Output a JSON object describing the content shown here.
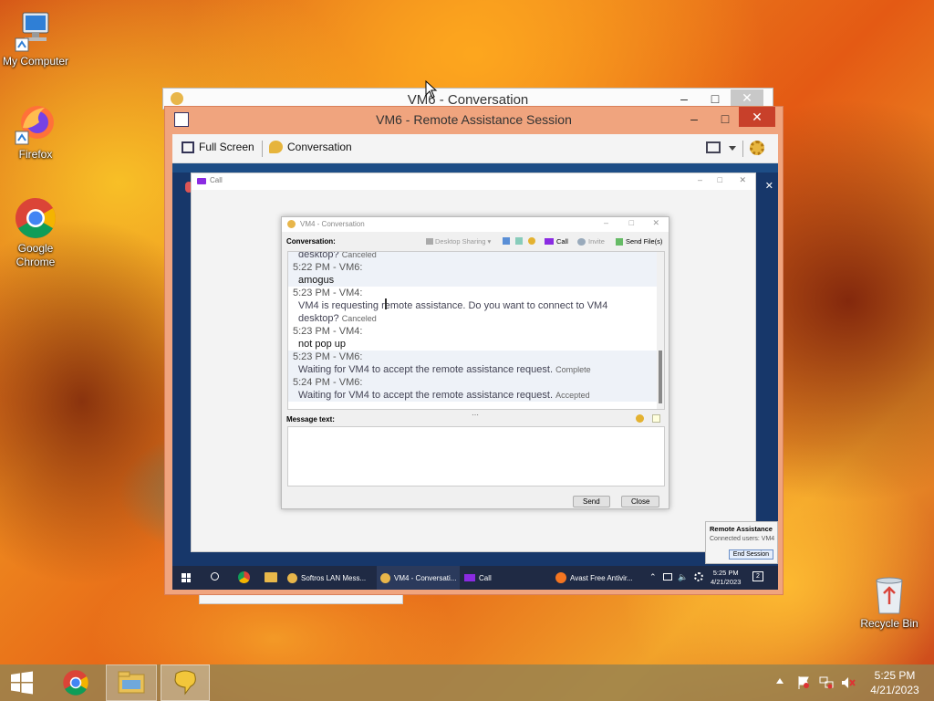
{
  "desktop": {
    "icons": [
      {
        "label": "My Computer",
        "icon": "computer-icon"
      },
      {
        "label": "Firefox",
        "icon": "firefox-icon"
      },
      {
        "label": "Google Chrome",
        "icon": "chrome-icon"
      },
      {
        "label": "Recycle Bin",
        "icon": "recycle-bin-icon"
      }
    ]
  },
  "bg_window": {
    "title": "VM6 - Conversation"
  },
  "ra_window": {
    "title": "VM6 - Remote Assistance Session",
    "toolbar": {
      "full_screen": "Full Screen",
      "conversation": "Conversation"
    }
  },
  "remote": {
    "call_window": {
      "title": "Call"
    },
    "conversation_window": {
      "title": "VM4 - Conversation",
      "conversation_label": "Conversation:",
      "toolbar": {
        "desktop_sharing": "Desktop Sharing",
        "call": "Call",
        "invite": "Invite",
        "send_files": "Send File(s)"
      },
      "lines": [
        {
          "kind": "msg",
          "text": "desktop?",
          "status": "Canceled"
        },
        {
          "kind": "hdr",
          "text": "5:22 PM - VM6:"
        },
        {
          "kind": "msg-bold",
          "text": "amogus"
        },
        {
          "kind": "hdr",
          "text": "5:23 PM - VM4:"
        },
        {
          "kind": "msg",
          "text": "VM4 is requesting remote assistance. Do you want to connect to VM4"
        },
        {
          "kind": "msg",
          "text": "desktop?",
          "status": "Canceled"
        },
        {
          "kind": "hdr",
          "text": "5:23 PM - VM4:"
        },
        {
          "kind": "msg-bold",
          "text": "not pop up"
        },
        {
          "kind": "hdr",
          "text": "5:23 PM - VM6:"
        },
        {
          "kind": "msg",
          "text": "Waiting for VM4 to accept the remote assistance request.",
          "status": "Complete"
        },
        {
          "kind": "hdr",
          "text": "5:24 PM - VM6:"
        },
        {
          "kind": "msg",
          "text": "Waiting for VM4 to accept the remote assistance request.",
          "status": "Accepted"
        }
      ],
      "message_label": "Message text:",
      "message_value": "",
      "send": "Send",
      "close": "Close"
    },
    "ra_popup": {
      "title": "Remote Assistance",
      "connected": "Connected users: VM4",
      "end_session": "End Session"
    },
    "taskbar": {
      "items": [
        {
          "label": "Softros LAN Mess...",
          "icon": "softros-icon"
        },
        {
          "label": "VM4 - Conversati...",
          "icon": "softros-icon"
        },
        {
          "label": "Call",
          "icon": "video-call-icon"
        },
        {
          "label": "Avast Free Antivir...",
          "icon": "avast-icon"
        }
      ],
      "time": "5:25 PM",
      "date": "4/21/2023",
      "notifications": "2"
    }
  },
  "host_taskbar": {
    "time": "5:25 PM",
    "date": "4/21/2023"
  },
  "colors": {
    "ra_frame": "#f0a47e",
    "remote_taskbar": "#1f2a44",
    "call_icon": "#8a2be2"
  }
}
